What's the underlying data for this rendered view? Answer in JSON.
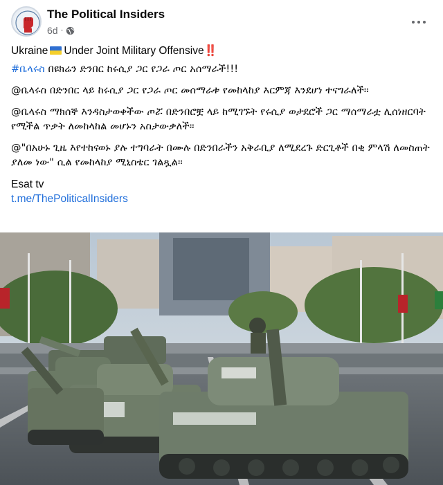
{
  "header": {
    "page_name": "The Political Insiders",
    "time": "6d",
    "separator": "·"
  },
  "post": {
    "line1_text": "Ukraine",
    "line1_text_2": "Under Joint Military Offensive",
    "line1_emphasis": "‼️",
    "line2_hashtag": "#ቤላሩስ",
    "line2_text": " በዩክሬን ድንበር ከሩሲያ ጋር የጋራ ጦር አሰማራች!!!",
    "para1": "@ቤላሩስ በድንበር ላይ ከሩሲያ ጋር የጋራ ጦር መሰማራቱ የመከላከያ እርምጃ እንደሆነ ተናግራለች።",
    "para2": "@ቤላሩስ ማክሰኞ እንዳስታወቀችው ጦሯ በድንበሮቿ ላይ ከሚገኙት የሩሲያ ወታደሮች ጋር ማሰማራቷ ሊሰነዘርባት የሚችል ጥቃት ለመከላከል መሆኑን አስታውቃለች።",
    "para3": "@\"በአሁኑ ጊዜ እየተከናወኑ ያሉ ተግባራት በሙሉ በድንበራችን አቅራቢያ ለሚደረጉ ድርጊቶች በቂ ምላሽ ለመስጠት ያለመ ነው\" ሲል የመከላከያ ሚኒስቴር ገልጿል።",
    "source": "Esat tv",
    "link": "t.me/ThePoliticalInsiders"
  },
  "colors": {
    "link": "#216fdb",
    "meta": "#65676b",
    "flag_blue": "#2f6fd1",
    "flag_yellow": "#f5cf2b"
  },
  "icons": {
    "avatar": "raised-fist-logo",
    "privacy": "globe-icon",
    "menu": "more-options-icon",
    "flag": "ukraine-flag-icon"
  }
}
